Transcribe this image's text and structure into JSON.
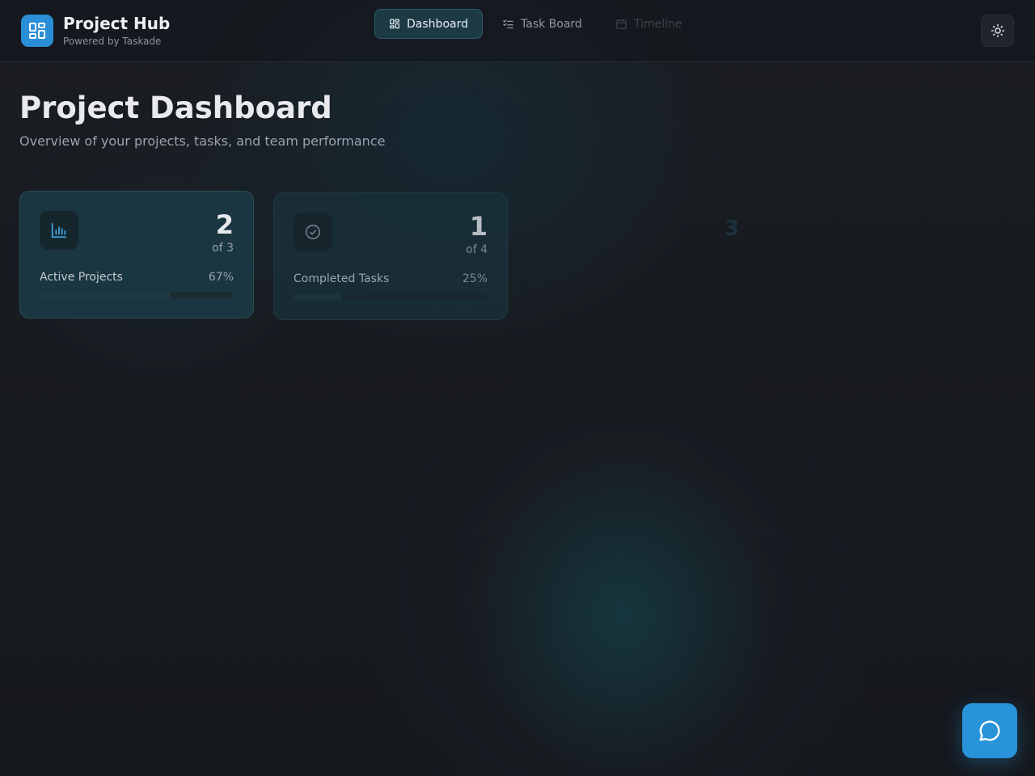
{
  "header": {
    "brand_title": "Project Hub",
    "brand_subtitle": "Powered by Taskade",
    "tabs": [
      {
        "label": "Dashboard",
        "icon": "grid-icon",
        "active": true
      },
      {
        "label": "Task Board",
        "icon": "checklist-icon",
        "active": false
      },
      {
        "label": "Timeline",
        "icon": "calendar-icon",
        "active": false
      }
    ],
    "theme_toggle_icon": "sun-icon"
  },
  "page": {
    "title": "Project Dashboard",
    "subtitle": "Overview of your projects, tasks, and team performance"
  },
  "stats": [
    {
      "value": "2",
      "of_text": "of 3",
      "label": "Active Projects",
      "percent_text": "67%",
      "percent": 67,
      "icon": "bar-chart-icon"
    },
    {
      "value": "1",
      "of_text": "of 4",
      "label": "Completed Tasks",
      "percent_text": "25%",
      "percent": 25,
      "icon": "check-circle-icon"
    },
    {
      "value": "3"
    }
  ],
  "chat_button_icon": "chat-bubble-icon",
  "colors": {
    "accent": "#2a8fd6",
    "active_tab_bg": "#1d3a44",
    "card_bg": "#1a3640"
  }
}
